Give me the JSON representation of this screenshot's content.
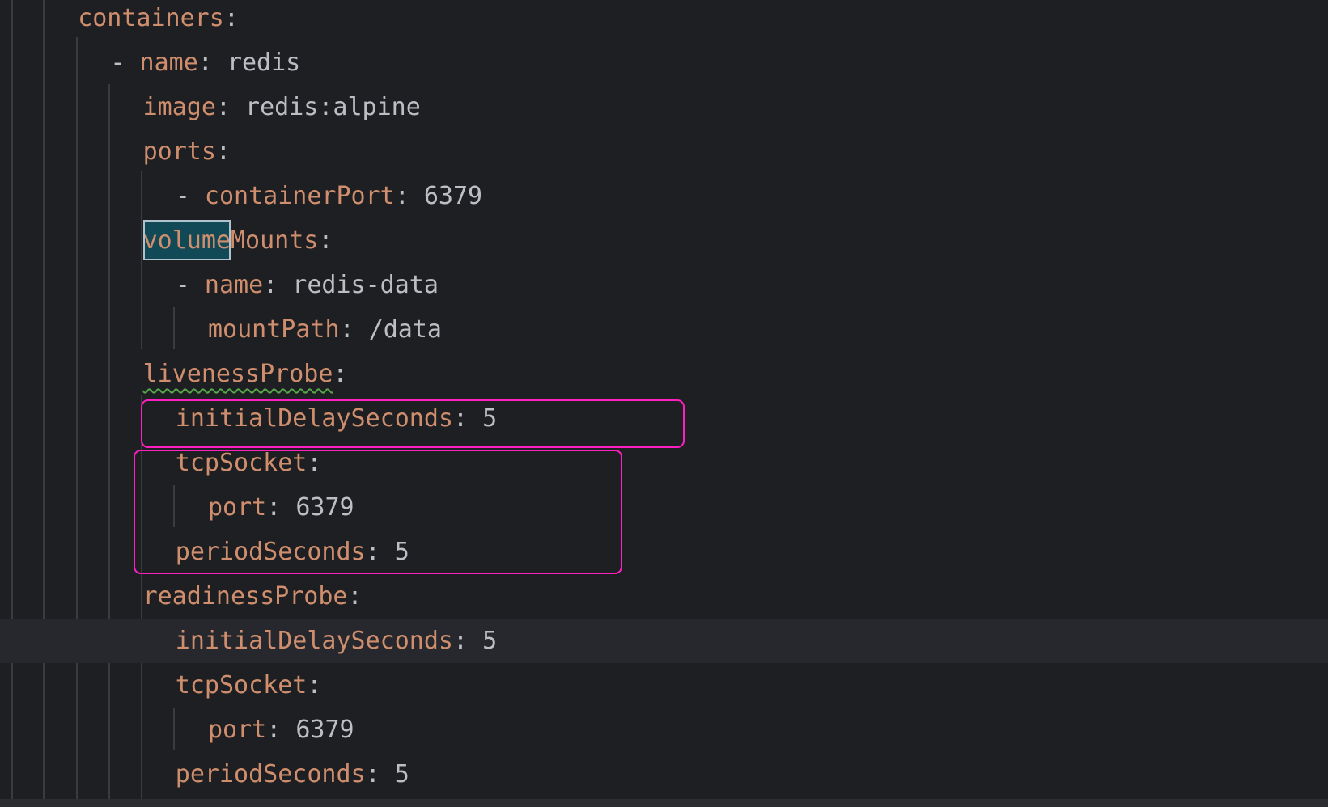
{
  "editor": {
    "lines": [
      {
        "indent": "  ",
        "parts": [
          {
            "t": "containers",
            "c": "key"
          },
          {
            "t": ":",
            "c": "punct"
          }
        ]
      },
      {
        "indent": "    ",
        "parts": [
          {
            "t": "- ",
            "c": "dash"
          },
          {
            "t": "name",
            "c": "key"
          },
          {
            "t": ": ",
            "c": "punct"
          },
          {
            "t": "redis",
            "c": "val"
          }
        ]
      },
      {
        "indent": "      ",
        "parts": [
          {
            "t": "image",
            "c": "key"
          },
          {
            "t": ": ",
            "c": "punct"
          },
          {
            "t": "redis:alpine",
            "c": "val"
          }
        ]
      },
      {
        "indent": "      ",
        "parts": [
          {
            "t": "ports",
            "c": "key"
          },
          {
            "t": ":",
            "c": "punct"
          }
        ]
      },
      {
        "indent": "        ",
        "parts": [
          {
            "t": "- ",
            "c": "dash"
          },
          {
            "t": "containerPort",
            "c": "key"
          },
          {
            "t": ": ",
            "c": "punct"
          },
          {
            "t": "6379",
            "c": "num"
          }
        ]
      },
      {
        "indent": "      ",
        "parts": [
          {
            "t": "volume",
            "c": "key",
            "match": true
          },
          {
            "t": "Mounts",
            "c": "key"
          },
          {
            "t": ":",
            "c": "punct"
          }
        ]
      },
      {
        "indent": "        ",
        "parts": [
          {
            "t": "- ",
            "c": "dash"
          },
          {
            "t": "name",
            "c": "key"
          },
          {
            "t": ": ",
            "c": "punct"
          },
          {
            "t": "redis-data",
            "c": "val"
          }
        ]
      },
      {
        "indent": "          ",
        "parts": [
          {
            "t": "mountPath",
            "c": "key"
          },
          {
            "t": ": ",
            "c": "punct"
          },
          {
            "t": "/data",
            "c": "val"
          }
        ]
      },
      {
        "indent": "      ",
        "parts": [
          {
            "t": "livenessProbe",
            "c": "key",
            "wavy": true
          },
          {
            "t": ":",
            "c": "punct"
          }
        ]
      },
      {
        "indent": "        ",
        "parts": [
          {
            "t": "initialDelaySeconds",
            "c": "key"
          },
          {
            "t": ": ",
            "c": "punct"
          },
          {
            "t": "5",
            "c": "num"
          }
        ]
      },
      {
        "indent": "        ",
        "parts": [
          {
            "t": "tcpSocket",
            "c": "key"
          },
          {
            "t": ":",
            "c": "punct"
          }
        ]
      },
      {
        "indent": "          ",
        "parts": [
          {
            "t": "port",
            "c": "key"
          },
          {
            "t": ": ",
            "c": "punct"
          },
          {
            "t": "6379",
            "c": "num"
          }
        ]
      },
      {
        "indent": "        ",
        "parts": [
          {
            "t": "periodSeconds",
            "c": "key"
          },
          {
            "t": ": ",
            "c": "punct"
          },
          {
            "t": "5",
            "c": "num"
          }
        ]
      },
      {
        "indent": "      ",
        "parts": [
          {
            "t": "readinessProbe",
            "c": "key"
          },
          {
            "t": ":",
            "c": "punct"
          }
        ]
      },
      {
        "indent": "        ",
        "parts": [
          {
            "t": "initialDelaySeconds",
            "c": "key"
          },
          {
            "t": ": ",
            "c": "punct"
          },
          {
            "t": "5",
            "c": "num"
          }
        ],
        "caret": true
      },
      {
        "indent": "        ",
        "parts": [
          {
            "t": "tcpSocket",
            "c": "key"
          },
          {
            "t": ":",
            "c": "punct"
          }
        ]
      },
      {
        "indent": "          ",
        "parts": [
          {
            "t": "port",
            "c": "key"
          },
          {
            "t": ": ",
            "c": "punct"
          },
          {
            "t": "6379",
            "c": "num"
          }
        ]
      },
      {
        "indent": "        ",
        "parts": [
          {
            "t": "periodSeconds",
            "c": "key"
          },
          {
            "t": ": ",
            "c": "punct"
          },
          {
            "t": "5",
            "c": "num"
          }
        ]
      }
    ]
  },
  "colors": {
    "background": "#1e1f22",
    "key": "#cf8e6d",
    "text": "#bcbec4",
    "annotation": "#ff1ec1",
    "search_match": "#114957",
    "caret_row": "#26282e"
  }
}
